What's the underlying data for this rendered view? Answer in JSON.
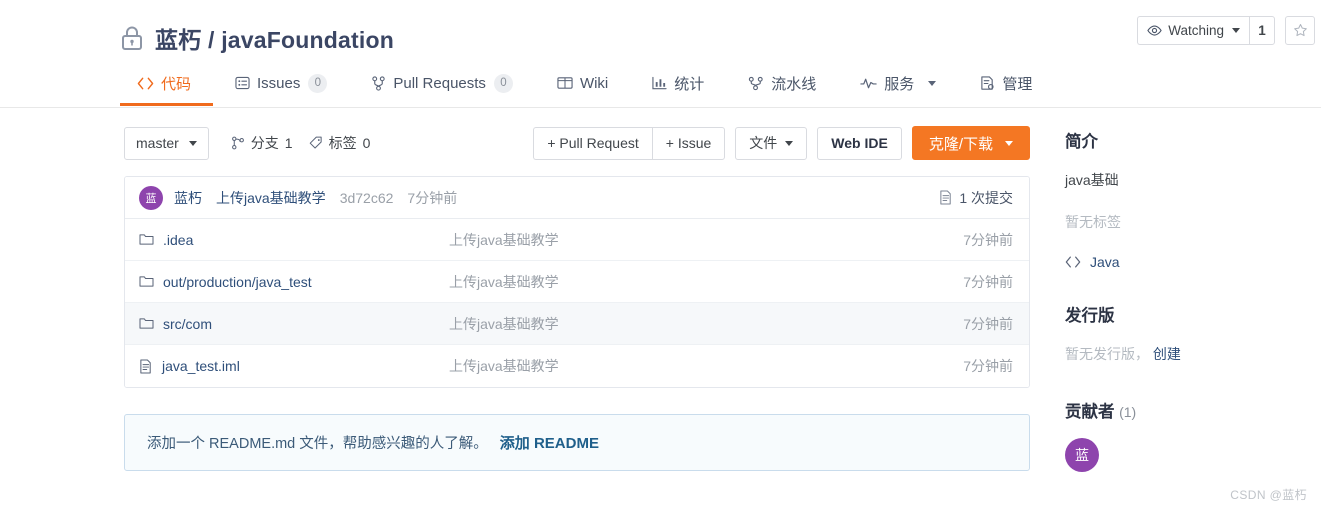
{
  "header": {
    "lock_icon": "lock-icon",
    "owner": "蓝朽",
    "separator": "/",
    "repo_name": "javaFoundation",
    "watch_label": "Watching",
    "watch_count": "1",
    "star_icon": "star-icon",
    "eye_icon": "eye-icon"
  },
  "nav": {
    "tabs": [
      {
        "label": "代码",
        "icon": "code-icon",
        "badge": "",
        "active": true,
        "dropdown": false
      },
      {
        "label": "Issues",
        "icon": "issue-list-icon",
        "badge": "0",
        "active": false,
        "dropdown": false
      },
      {
        "label": "Pull Requests",
        "icon": "pull-request-icon",
        "badge": "0",
        "active": false,
        "dropdown": false
      },
      {
        "label": "Wiki",
        "icon": "book-icon",
        "badge": "",
        "active": false,
        "dropdown": false
      },
      {
        "label": "统计",
        "icon": "chart-icon",
        "badge": "",
        "active": false,
        "dropdown": false
      },
      {
        "label": "流水线",
        "icon": "pipeline-icon",
        "badge": "",
        "active": false,
        "dropdown": false
      },
      {
        "label": "服务",
        "icon": "pulse-icon",
        "badge": "",
        "active": false,
        "dropdown": true
      },
      {
        "label": "管理",
        "icon": "settings-doc-icon",
        "badge": "",
        "active": false,
        "dropdown": false
      }
    ]
  },
  "toolbar": {
    "branch": "master",
    "branch_meta_label": "分支",
    "branch_meta_count": "1",
    "tag_meta_label": "标签",
    "tag_meta_count": "0",
    "pull_request_btn": "+ Pull Request",
    "issue_btn": "+ Issue",
    "file_btn": "文件",
    "web_ide_btn": "Web IDE",
    "clone_btn": "克隆/下载"
  },
  "commit": {
    "avatar_initial": "蓝",
    "author": "蓝朽",
    "message": "上传java基础教学",
    "hash": "3d72c62",
    "time": "7分钟前",
    "count_label": "1 次提交"
  },
  "files": {
    "rows": [
      {
        "name": ".idea",
        "type": "folder",
        "commit": "上传java基础教学",
        "time": "7分钟前",
        "hover": false
      },
      {
        "name": "out/production/java_test",
        "type": "folder",
        "commit": "上传java基础教学",
        "time": "7分钟前",
        "hover": false
      },
      {
        "name": "src/com",
        "type": "folder",
        "commit": "上传java基础教学",
        "time": "7分钟前",
        "hover": true
      },
      {
        "name": "java_test.iml",
        "type": "file",
        "commit": "上传java基础教学",
        "time": "7分钟前",
        "hover": false
      }
    ]
  },
  "readme": {
    "text": "添加一个 README.md 文件，帮助感兴趣的人了解。",
    "link": "添加 README"
  },
  "sidebar": {
    "about_title": "简介",
    "description": "java基础",
    "no_tags": "暂无标签",
    "language": "Java",
    "releases_title": "发行版",
    "no_releases": "暂无发行版，",
    "create_release": "创建",
    "contributors_title": "贡献者",
    "contributors_count": "(1)",
    "contributor_initial": "蓝"
  },
  "watermark": "CSDN @蓝朽",
  "colors": {
    "accent_orange": "#f06b1d",
    "button_orange": "#f47723",
    "link_blue": "#2f4f7a",
    "avatar_purple": "#8e44ad",
    "muted_gray": "#9aa0a8"
  }
}
